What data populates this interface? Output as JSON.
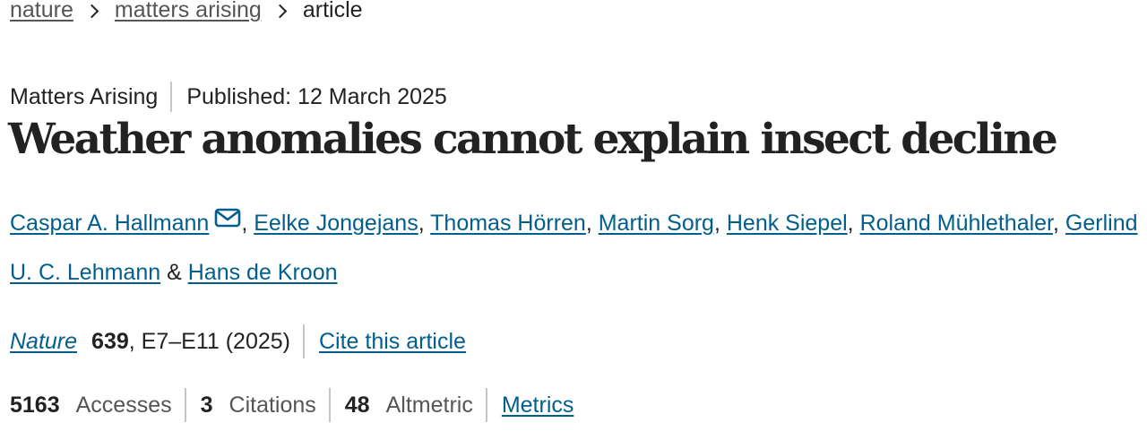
{
  "breadcrumb": {
    "items": [
      "nature",
      "matters arising"
    ],
    "current": "article"
  },
  "article_meta": {
    "type": "Matters Arising",
    "published": "Published: 12 March 2025"
  },
  "title": "Weather anomalies cannot explain insect decline",
  "authors": {
    "list": [
      "Caspar A. Hallmann",
      "Eelke Jongejans",
      "Thomas Hörren",
      "Martin Sorg",
      "Henk Siepel",
      "Roland Mühlethaler",
      "Gerlind U. C. Lehmann",
      "Hans de Kroon"
    ],
    "comma": ",",
    "ampersand": "&",
    "corresponding_icon": "envelope-icon"
  },
  "citation": {
    "journal": "Nature",
    "volume": "639",
    "pages_year": ", E7–E11 (2025)",
    "cite_label": "Cite this article"
  },
  "metrics": {
    "accesses_value": "5163",
    "accesses_label": "Accesses",
    "citations_value": "3",
    "citations_label": "Citations",
    "altmetric_value": "48",
    "altmetric_label": "Altmetric",
    "metrics_link": "Metrics"
  },
  "colors": {
    "link": "#025e8d",
    "text": "#222222",
    "muted": "#555555",
    "separator": "#c6c6c6"
  }
}
